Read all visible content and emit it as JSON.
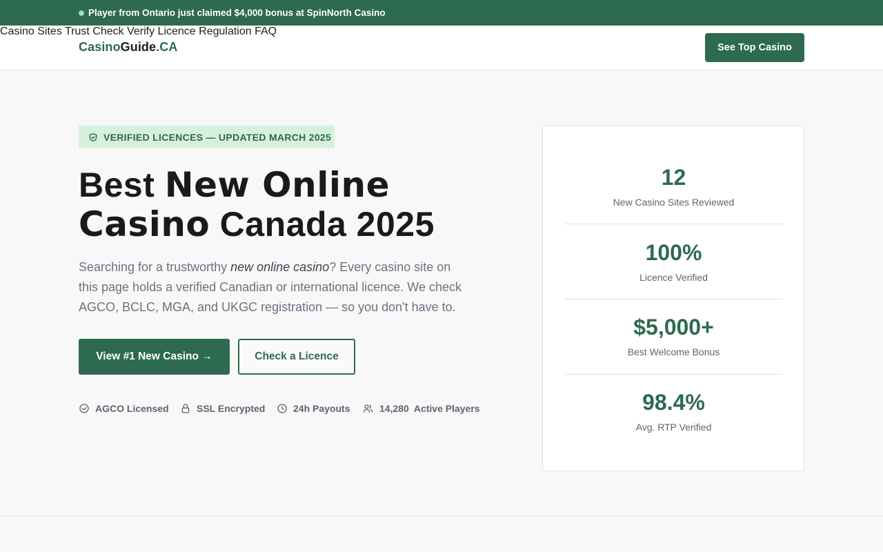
{
  "ticker": {
    "text": "Player from Ontario just claimed $4,000 bonus at SpinNorth Casino"
  },
  "logo": {
    "part1": "Casino",
    "part2": "Guide",
    "part3": ".CA"
  },
  "nav": {
    "items": [
      "Casino Sites",
      "Trust Check",
      "Verify Licence",
      "Regulation",
      "FAQ"
    ],
    "cta": "See Top Casino"
  },
  "hero": {
    "badge": "VERIFIED LICENCES — UPDATED MARCH 2025",
    "headline_a1": "Best ",
    "headline_b1": "New Online",
    "headline_b2": "Casino",
    "headline_a2": " Canada 2025",
    "lead_pre": "Searching for a trustworthy ",
    "lead_em": "new online casino",
    "lead_post": "? Every casino site on this page holds a verified Canadian or international licence. We check AGCO, BCLC, MGA, and UKGC registration — so you don't have to.",
    "primary_btn": "View #1 New Casino →",
    "secondary_btn": "Check a Licence",
    "trust": [
      {
        "icon": "check-circle-icon",
        "label": "AGCO Licensed"
      },
      {
        "icon": "lock-icon",
        "label": "SSL Encrypted"
      },
      {
        "icon": "clock-icon",
        "label": "24h Payouts"
      },
      {
        "icon": "users-icon",
        "count": "14,280",
        "label": "Active Players"
      }
    ]
  },
  "stats": [
    {
      "value": "12",
      "label": "New Casino Sites Reviewed"
    },
    {
      "value": "100%",
      "label": "Licence Verified"
    },
    {
      "value": "$5,000+",
      "label": "Best Welcome Bonus"
    },
    {
      "value": "98.4%",
      "label": "Avg. RTP Verified"
    }
  ],
  "colors": {
    "brand": "#2d6a4f",
    "badge_bg": "#d7f0de",
    "text_muted": "#5a6472"
  }
}
